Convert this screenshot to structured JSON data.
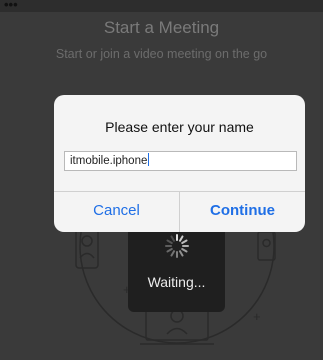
{
  "background": {
    "title": "Start a Meeting",
    "subtitle": "Start or join a video meeting on the go"
  },
  "dialog": {
    "title": "Please enter your name",
    "input_value": "itmobile.iphone",
    "cancel_label": "Cancel",
    "continue_label": "Continue"
  },
  "hud": {
    "label": "Waiting..."
  },
  "colors": {
    "accent": "#1f6fe6",
    "dialog_bg": "#f4f4f4",
    "overlay_bg": "#3a3a3a",
    "hud_bg": "#1f1f1f"
  }
}
